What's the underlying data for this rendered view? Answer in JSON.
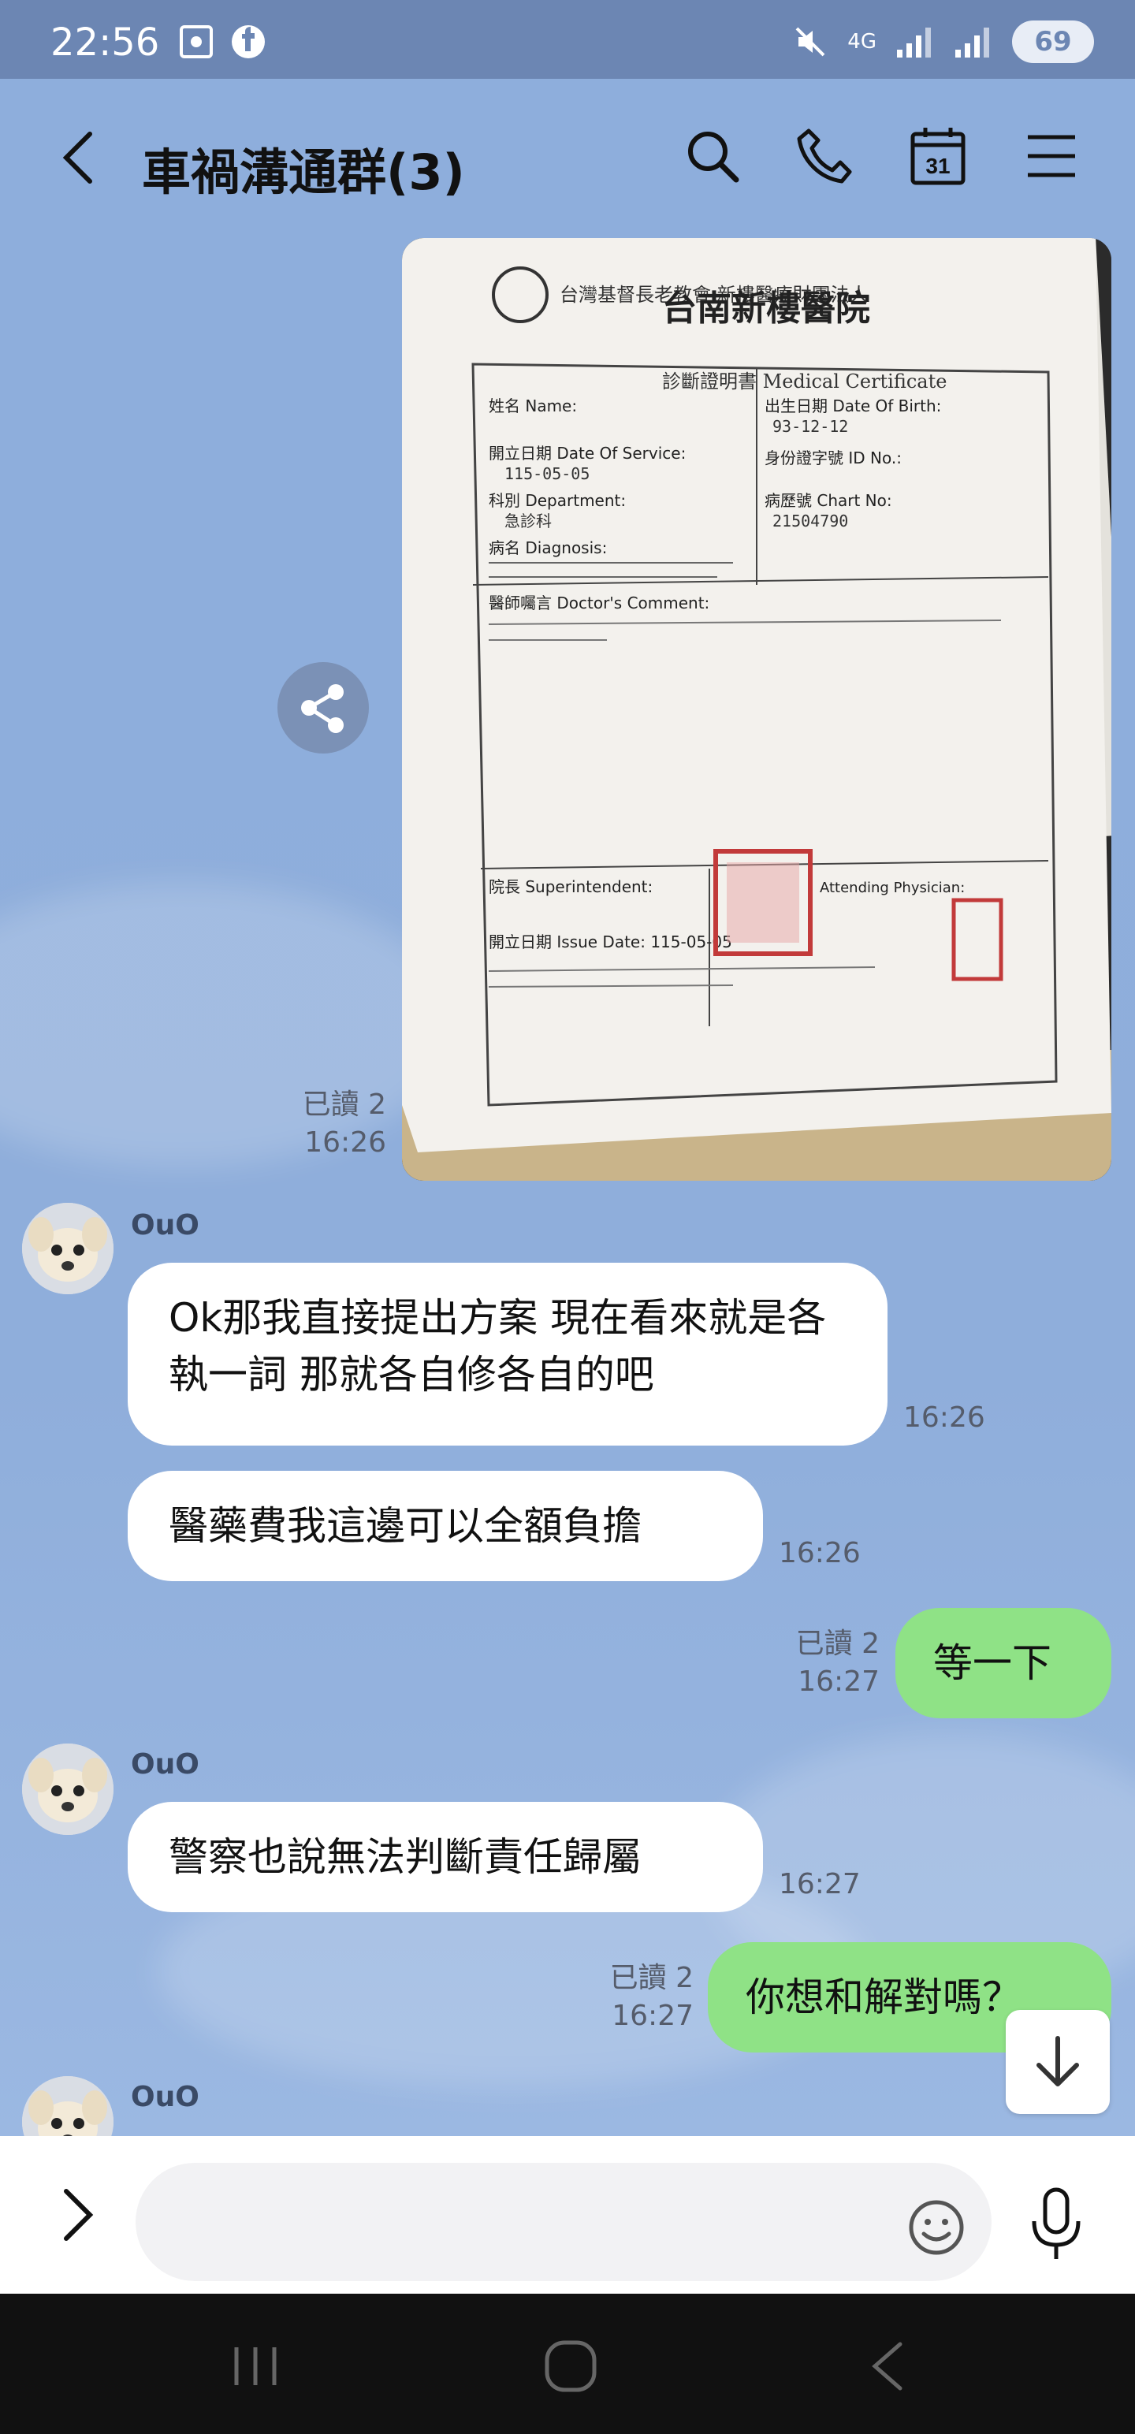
{
  "status_bar": {
    "time": "22:56",
    "network": "4G",
    "battery": "69"
  },
  "header": {
    "title": "車禍溝通群(3)"
  },
  "messages": {
    "photo_read": "已讀 2",
    "photo_time": "16:26",
    "photo_text": {
      "hospital": "台南新樓醫院",
      "org": "台灣基督長老教會 新樓醫療財團法人",
      "cert_title": "診斷證明書 Medical Certificate",
      "name_label": "姓名 Name:",
      "dob_label": "出生日期 Date Of Birth:",
      "dob": "93-12-12",
      "service_label": "開立日期 Date Of Service:",
      "service_date": "115-05-05",
      "id_label": "身份證字號 ID No.:",
      "dept_label": "科別 Department:",
      "dept": "急診科",
      "chart_label": "病歷號 Chart No:",
      "chart_no": "21504790",
      "diagnosis_label": "病名 Diagnosis:",
      "comment_label": "醫師囑言 Doctor's Comment:",
      "super_label": "院長 Superintendent:",
      "physician_label": "Attending Physician:",
      "issue_label": "開立日期 Issue Date: 115-05-05"
    },
    "m1_sender": "OuO",
    "m1_text": "Ok那我直接提出方案 現在看來就是各執一詞 那就各自修各自的吧",
    "m1_time": "16:26",
    "m2_text": "醫藥費我這邊可以全額負擔",
    "m2_time": "16:26",
    "m3_read": "已讀 2",
    "m3_time": "16:27",
    "m3_text": "等一下",
    "m4_sender": "OuO",
    "m4_text": "警察也說無法判斷責任歸屬",
    "m4_time": "16:27",
    "m5_read": "已讀 2",
    "m5_time": "16:27",
    "m5_text": "你想和解對嗎？",
    "m6_sender": "OuO"
  },
  "colors": {
    "chat_bg": "#8eaedc",
    "outgoing_bubble": "#8fe286",
    "incoming_bubble": "#ffffff",
    "status_bar": "#6c86b3"
  },
  "icons": [
    "back-icon",
    "search-icon",
    "phone-icon",
    "calendar-icon",
    "menu-icon",
    "share-icon",
    "chevron-down-icon",
    "expand-icon",
    "emoji-icon",
    "mic-icon"
  ]
}
